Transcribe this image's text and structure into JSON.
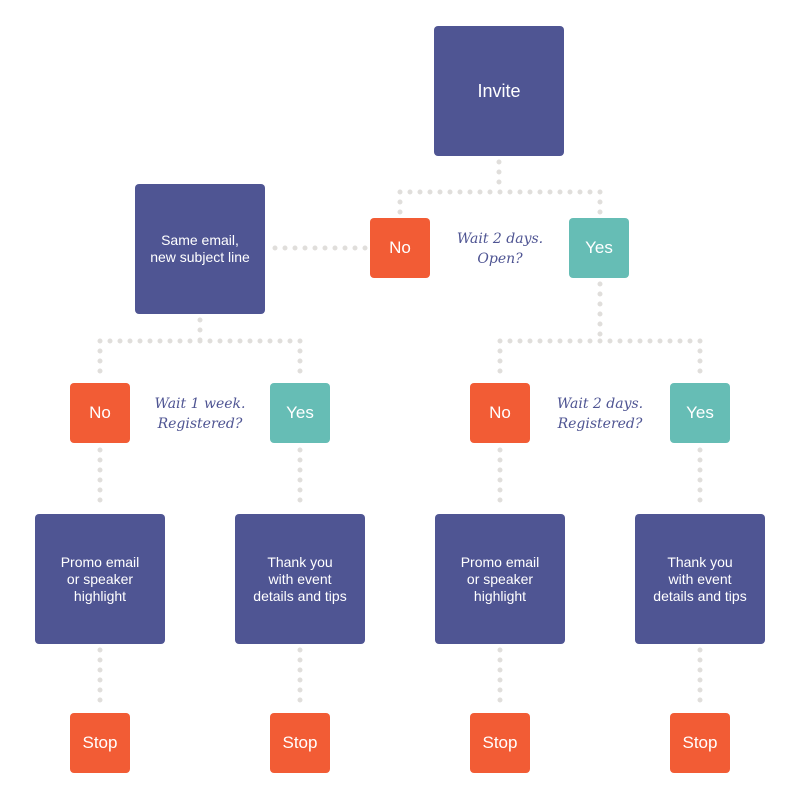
{
  "colors": {
    "process": "#4f5593",
    "no": "#f25c35",
    "yes": "#66bdb5",
    "connector": "#e0dedb",
    "label": "#4f5593"
  },
  "nodes": {
    "invite": "Invite",
    "same_email": "Same email,\nnew subject line",
    "no_open": "No",
    "yes_open": "Yes",
    "q_open": "Wait 2 days.\nOpen?",
    "no_reg_left": "No",
    "yes_reg_left": "Yes",
    "q_reg_left": "Wait 1 week.\nRegistered?",
    "no_reg_right": "No",
    "yes_reg_right": "Yes",
    "q_reg_right": "Wait 2 days.\nRegistered?",
    "promo_left": "Promo email\nor speaker\nhighlight",
    "thanks_left": "Thank you\nwith event\ndetails and tips",
    "promo_right": "Promo email\nor speaker\nhighlight",
    "thanks_right": "Thank you\nwith event\ndetails and tips",
    "stop1": "Stop",
    "stop2": "Stop",
    "stop3": "Stop",
    "stop4": "Stop"
  }
}
